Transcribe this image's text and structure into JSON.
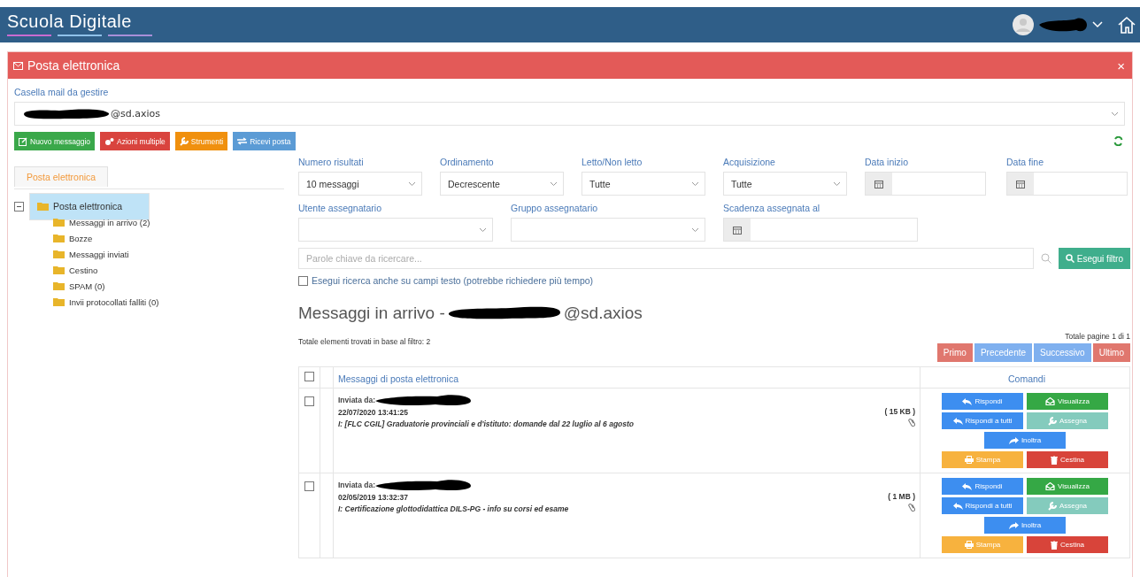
{
  "app": {
    "title": "Scuola Digitale"
  },
  "panel": {
    "title": "Posta elettronica",
    "close": "×"
  },
  "mailbox": {
    "label": "Casella mail da gestire",
    "value": "@sd.axios"
  },
  "toolbar": [
    {
      "label": "Nuovo messaggio",
      "kind": "new"
    },
    {
      "label": "Azioni multiple",
      "kind": "multi"
    },
    {
      "label": "Strumenti",
      "kind": "tools"
    },
    {
      "label": "Ricevi posta",
      "kind": "receive"
    }
  ],
  "sidebar": {
    "tab": "Posta elettronica",
    "tree": [
      {
        "label": "Posta elettronica",
        "selected": true,
        "expanded": true,
        "children": [
          {
            "label": "Messaggi in arrivo (2)",
            "selected": false
          },
          {
            "label": "Bozze",
            "selected": false
          },
          {
            "label": "Messaggi inviati",
            "selected": false
          },
          {
            "label": "Cestino",
            "selected": false
          },
          {
            "label": "SPAM (0)",
            "selected": false
          },
          {
            "label": "Invii protocollati falliti (0)",
            "selected": false
          }
        ]
      }
    ]
  },
  "filters": [
    [
      {
        "label": "Numero risultati",
        "kind": "select",
        "value": "10 messaggi"
      },
      {
        "label": "Ordinamento",
        "kind": "select",
        "value": "Decrescente"
      },
      {
        "label": "Letto/Non letto",
        "kind": "select",
        "value": "Tutte"
      },
      {
        "label": "Acquisizione",
        "kind": "select",
        "value": "Tutte"
      },
      {
        "label": "Data inizio",
        "kind": "date"
      },
      {
        "label": "Data fine",
        "kind": "date"
      }
    ],
    [
      {
        "label": "Utente assegnatario",
        "kind": "select"
      },
      {
        "label": "Gruppo assegnatario",
        "kind": "select"
      },
      {
        "label": "Scadenza assegnata al",
        "kind": "date"
      }
    ]
  ],
  "search": {
    "placeholder": "Parole chiave da ricercare...",
    "button": "Esegui filtro"
  },
  "fulltext": {
    "label": "Esegui ricerca anche su campi testo (potrebbe richiedere più tempo)",
    "checked": false
  },
  "list": {
    "title": "Messaggi in arrivo -",
    "title_suffix": "@sd.axios",
    "total": "Totale elementi trovati in base al filtro: 2",
    "pages": "Totale pagine 1 di 1",
    "pagination": [
      {
        "label": "Primo",
        "kind": "edge"
      },
      {
        "label": "Precedente",
        "kind": "step"
      },
      {
        "label": "Successivo",
        "kind": "step"
      },
      {
        "label": "Ultimo",
        "kind": "edge"
      }
    ],
    "columns": [
      "Messaggi di posta elettronica",
      "Comandi"
    ],
    "select_all": false,
    "rows": [
      {
        "checked": false,
        "sender_label": "Inviata da:",
        "date": "22/07/2020 13:41:25",
        "subject": "I: [FLC CGIL] Graduatorie provinciali e d'istituto: domande dal 22 luglio al 6 agosto",
        "size": "( 15 KB )",
        "attachment": true,
        "commands": [
          {
            "label": "Rispondi",
            "kind": "reply"
          },
          {
            "label": "Visualizza",
            "kind": "view"
          },
          {
            "label": "Rispondi a tutti",
            "kind": "reply"
          },
          {
            "label": "Assegna",
            "kind": "assign"
          },
          {
            "label": "Inoltra",
            "kind": "forward"
          },
          {
            "label": "Stampa",
            "kind": "print"
          },
          {
            "label": "Cestina",
            "kind": "delete"
          }
        ]
      },
      {
        "checked": false,
        "sender_label": "Inviata da:",
        "date": "02/05/2019 13:32:37",
        "subject": "I: Certificazione glottodidattica DILS-PG - info su corsi ed esame",
        "size": "( 1 MB )",
        "attachment": true,
        "commands": [
          {
            "label": "Rispondi",
            "kind": "reply"
          },
          {
            "label": "Visualizza",
            "kind": "view"
          },
          {
            "label": "Rispondi a tutti",
            "kind": "reply"
          },
          {
            "label": "Assegna",
            "kind": "assign"
          },
          {
            "label": "Inoltra",
            "kind": "forward"
          },
          {
            "label": "Stampa",
            "kind": "print"
          },
          {
            "label": "Cestina",
            "kind": "delete"
          }
        ]
      }
    ]
  }
}
